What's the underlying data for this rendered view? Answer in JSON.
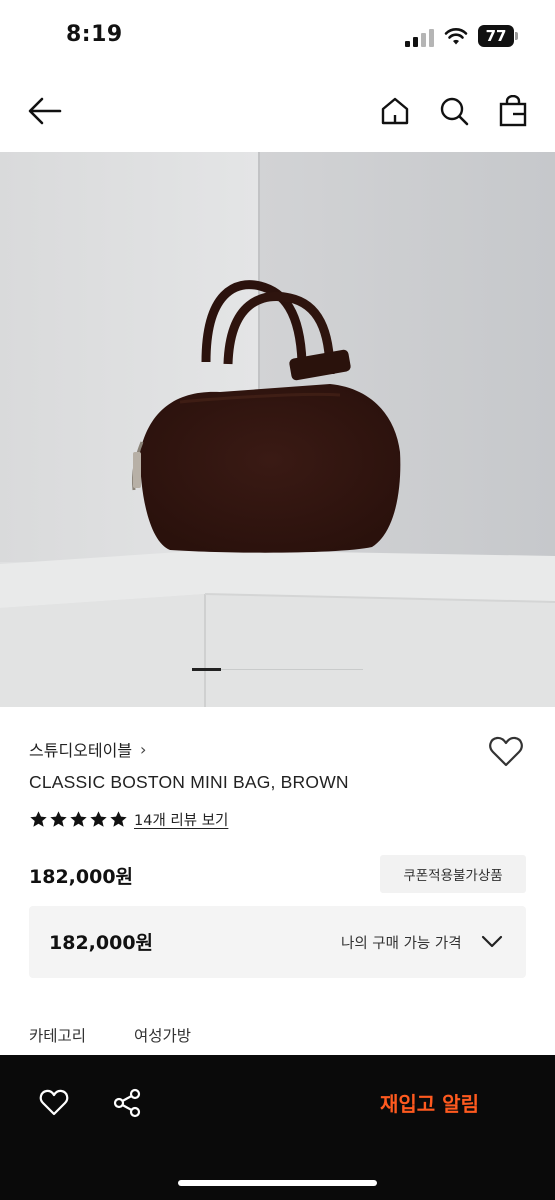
{
  "status_bar": {
    "time": "8:19",
    "battery": "77"
  },
  "header": {
    "icons": [
      "back-arrow-icon",
      "home-icon",
      "search-icon",
      "shopping-bag-icon"
    ]
  },
  "gallery": {
    "image": "brown-suede-boston-mini-bag-photo",
    "current_index": 1
  },
  "product": {
    "brand": "스튜디오테이블",
    "brand_chevron": "›",
    "name": "CLASSIC BOSTON MINI BAG, BROWN",
    "rating_stars": 5,
    "review_link": "14개 리뷰 보기",
    "price": "182,000원",
    "coupon_badge": "쿠폰적용불가상품",
    "purchase_price": {
      "value": "182,000원",
      "label": "나의 구매 가능 가격"
    },
    "category": {
      "label": "카테고리",
      "value": "여성가방"
    }
  },
  "bottom_bar": {
    "restock_label": "재입고 알림",
    "accent_color": "#ff5a1f"
  }
}
